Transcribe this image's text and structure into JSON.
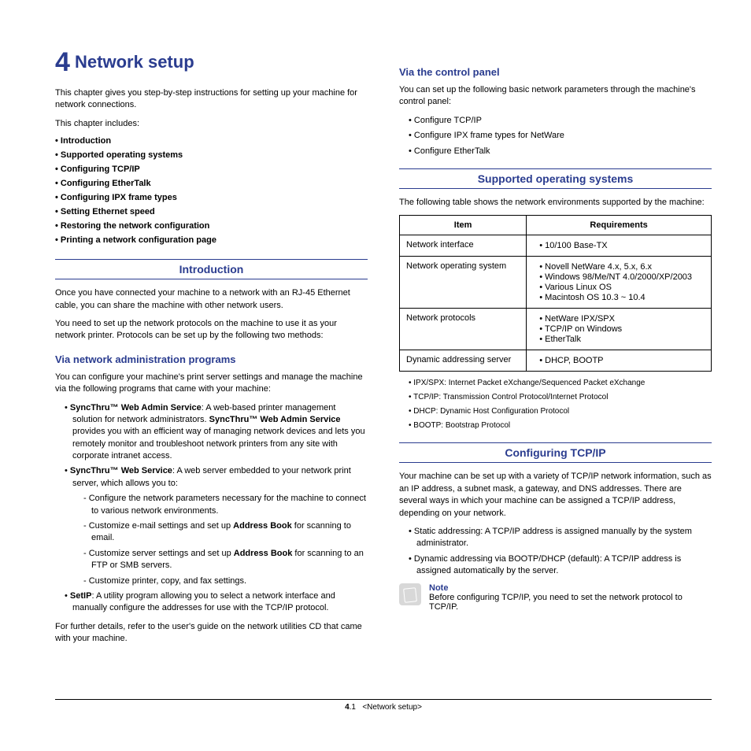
{
  "chapter": {
    "number": "4",
    "title": "Network setup",
    "intro_p1": "This chapter gives you step-by-step instructions for setting up your machine for network connections.",
    "intro_p2": "This chapter includes:",
    "toc": [
      "Introduction",
      "Supported operating systems",
      "Configuring TCP/IP",
      "Configuring EtherTalk",
      "Configuring IPX frame types",
      "Setting Ethernet speed",
      "Restoring the network configuration",
      "Printing a network configuration page"
    ]
  },
  "left": {
    "intro_h": "Introduction",
    "intro_p1": "Once you have connected your machine to a network with an RJ-45 Ethernet cable, you can share the machine with other network users.",
    "intro_p2": "You need to set up the network protocols on the machine to use it as your network printer. Protocols can be set up by the following two methods:",
    "admin_h": "Via network administration programs",
    "admin_p1": "You can configure your machine's print server settings and manage the machine via the following programs that came with your machine:",
    "admin_b1_lead": "SyncThru™ Web Admin Service",
    "admin_b1_rest": ": A web-based printer management solution for network administrators. ",
    "admin_b1_bold2": "SyncThru™ Web Admin Service",
    "admin_b1_tail": " provides you with an efficient way of managing network devices and lets you remotely monitor and troubleshoot network printers from any site with corporate intranet access.",
    "admin_b2_lead": "SyncThru™ Web Service",
    "admin_b2_rest": ": A web server embedded to your network print server, which allows you to:",
    "admin_d1": "Configure the network parameters necessary for the machine to connect to various network environments.",
    "admin_d2a": "Customize e-mail settings and set up ",
    "admin_d2b": "Address Book",
    "admin_d2c": " for scanning to email.",
    "admin_d3a": "Customize server settings and set up ",
    "admin_d3b": "Address Book",
    "admin_d3c": " for scanning to an FTP or SMB servers.",
    "admin_d4": "Customize printer, copy, and fax settings.",
    "admin_b3_lead": "SetIP",
    "admin_b3_rest": ": A utility program allowing you to select a network interface and manually configure the addresses for use with the TCP/IP protocol.",
    "admin_tail": "For further details, refer to the user's guide on the network utilities CD that came with your machine."
  },
  "right": {
    "cp_h": "Via the control panel",
    "cp_p1": "You can set up the following basic network parameters through the machine's control panel:",
    "cp_list": [
      "Configure TCP/IP",
      "Configure IPX frame types for NetWare",
      "Configure EtherTalk"
    ],
    "os_h": "Supported operating systems",
    "os_p1": "The following table shows the network environments supported by the machine:",
    "table": {
      "h1": "Item",
      "h2": "Requirements",
      "rows": [
        {
          "item": "Network interface",
          "reqs": [
            "10/100 Base-TX"
          ]
        },
        {
          "item": "Network operating system",
          "reqs": [
            "Novell NetWare 4.x, 5.x, 6.x",
            "Windows 98/Me/NT 4.0/2000/XP/2003",
            "Various Linux OS",
            "Macintosh OS 10.3 ~ 10.4"
          ]
        },
        {
          "item": "Network protocols",
          "reqs": [
            "NetWare IPX/SPX",
            "TCP/IP on Windows",
            "EtherTalk"
          ]
        },
        {
          "item": "Dynamic addressing server",
          "reqs": [
            "DHCP, BOOTP"
          ]
        }
      ]
    },
    "legend": [
      "IPX/SPX: Internet Packet eXchange/Sequenced Packet eXchange",
      "TCP/IP: Transmission Control Protocol/Internet Protocol",
      "DHCP: Dynamic Host Configuration Protocol",
      "BOOTP: Bootstrap Protocol"
    ],
    "tcp_h": "Configuring TCP/IP",
    "tcp_p1": "Your machine can be set up with a variety of TCP/IP network information, such as an IP address, a subnet mask, a gateway, and DNS addresses. There are several ways in which your machine can be assigned a TCP/IP address, depending on your network.",
    "tcp_list": [
      "Static addressing: A TCP/IP address is assigned manually by the system administrator.",
      "Dynamic addressing via BOOTP/DHCP (default): A TCP/IP address is assigned automatically by the server."
    ],
    "note_label": "Note",
    "note_text": "Before configuring TCP/IP, you need to set the network protocol to TCP/IP."
  },
  "footer": {
    "page_major": "4",
    "page_minor": ".1",
    "crumb": "<Network setup>"
  }
}
